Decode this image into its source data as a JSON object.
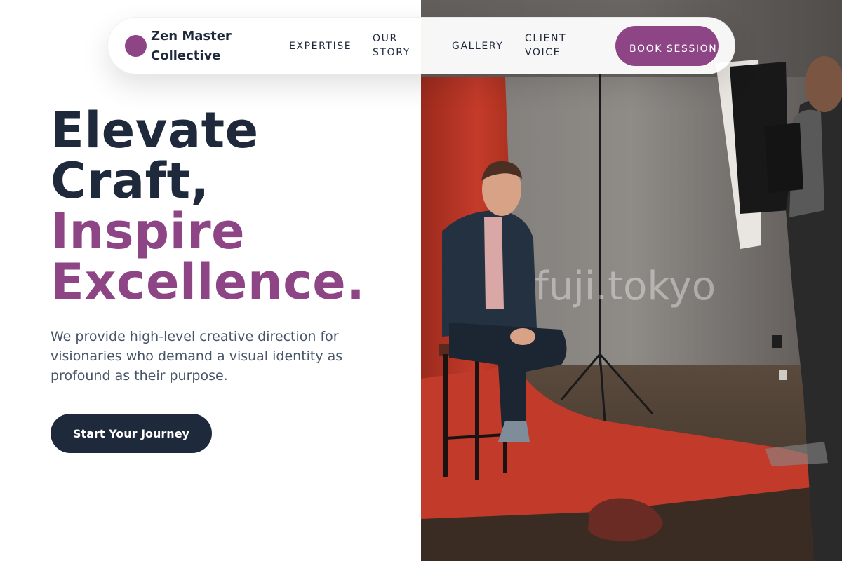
{
  "brand": {
    "name": "Zen Master Collective",
    "logo_icon": "circle-logo-icon",
    "accent_color": "#8e4585"
  },
  "nav": {
    "links": [
      {
        "label": "EXPERTISE"
      },
      {
        "label": "OUR STORY"
      },
      {
        "label": "GALLERY"
      },
      {
        "label": "CLIENT VOICE"
      }
    ],
    "cta_label": "BOOK SESSION"
  },
  "hero": {
    "headline_lines": [
      "Elevate",
      "Craft,",
      "Inspire",
      "Excellence."
    ],
    "description": "We provide high-level creative direction for visionaries who demand a visual identity as profound as their purpose.",
    "button_label": "Start Your Journey",
    "text_color": "#1e293b"
  },
  "photo": {
    "watermark": "fuji.tokyo"
  }
}
